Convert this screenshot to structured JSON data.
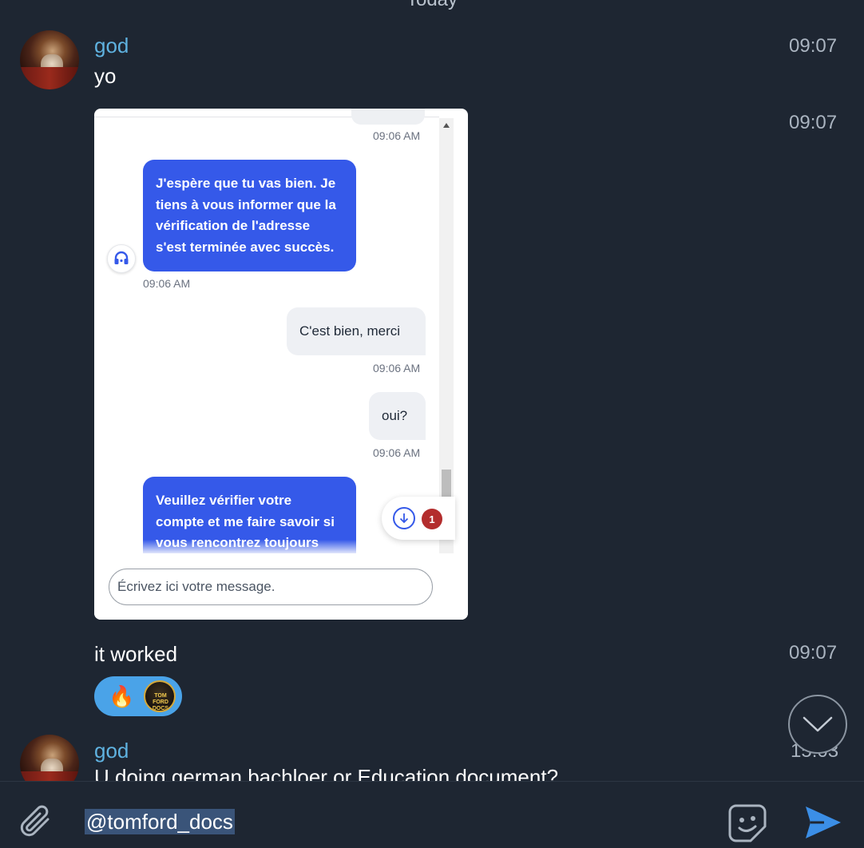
{
  "date_separator": "Today",
  "messages": [
    {
      "sender": "god",
      "text": "yo",
      "time": "09:07"
    },
    {
      "time": "09:07",
      "screenshot": {
        "time_top": "09:06 AM",
        "agent_message": "J'espère que tu vas bien. Je tiens à vous informer que la vérification de l'adresse s'est terminée avec succès.",
        "agent_time": "09:06 AM",
        "user_message_1": "C'est bien, merci",
        "user_time_1": "09:06 AM",
        "user_message_2": "oui?",
        "user_time_2": "09:06 AM",
        "agent_message_2": "Veuillez vérifier votre compte et me faire savoir si vous rencontrez toujours",
        "unread_badge": "1",
        "input_placeholder": "Écrivez ici votre message."
      }
    },
    {
      "text": "it worked",
      "time": "09:07",
      "reactions": {
        "emoji": "🔥",
        "reactor_avatar_text": "TOM FORD DOCS"
      }
    },
    {
      "sender": "god",
      "text": "U doing german bachloer or Education document?",
      "time": "15:03"
    }
  ],
  "composer": {
    "text": "@tomford_docs"
  },
  "icons": {
    "attach": "paperclip-icon",
    "sticker": "sticker-icon",
    "send": "send-icon",
    "scroll_down": "chevron-down-icon"
  },
  "colors": {
    "background": "#1e2632",
    "sender": "#5fb2e0",
    "accent": "#3b8ee6",
    "chat_bubble_blue": "#3559e9"
  }
}
